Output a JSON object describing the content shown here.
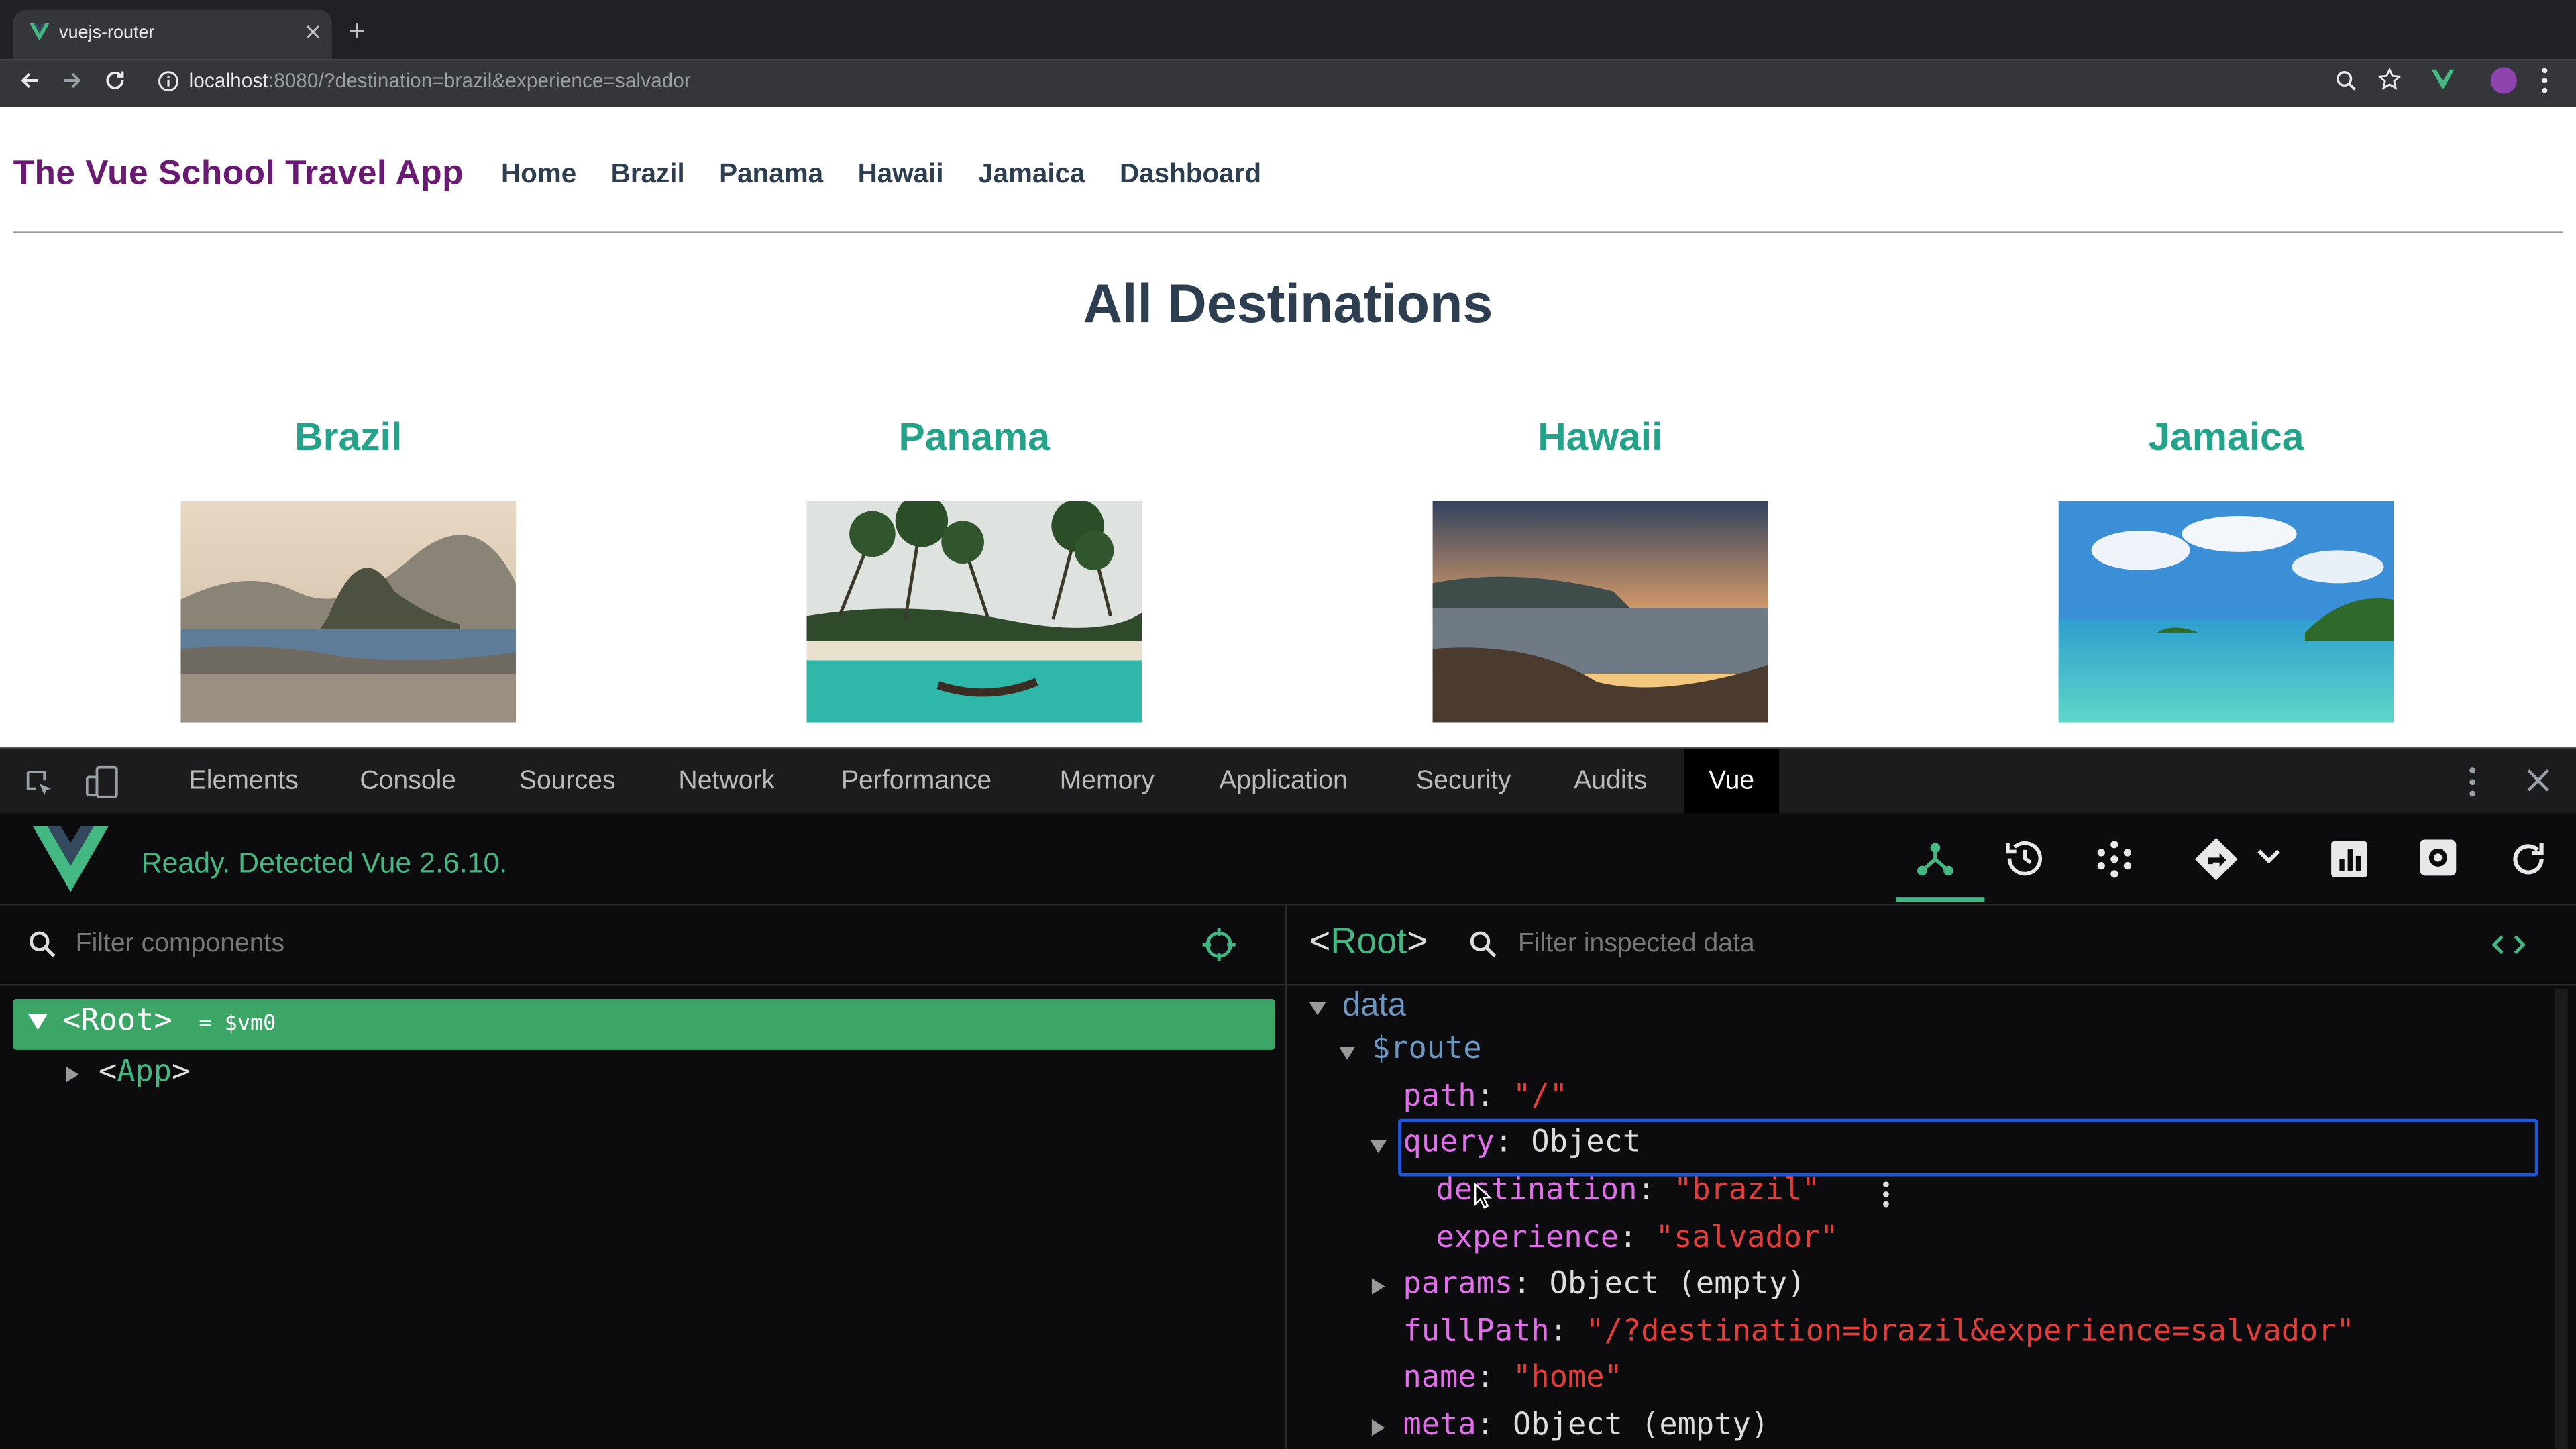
{
  "browser": {
    "tab_title": "vuejs-router",
    "new_tab": "+",
    "url_host": "localhost",
    "url_rest": ":8080/?destination=brazil&experience=salvador"
  },
  "page": {
    "brand": "The Vue School Travel App",
    "nav": [
      "Home",
      "Brazil",
      "Panama",
      "Hawaii",
      "Jamaica",
      "Dashboard"
    ],
    "heading": "All Destinations",
    "destinations": [
      "Brazil",
      "Panama",
      "Hawaii",
      "Jamaica"
    ]
  },
  "devtools": {
    "tabs": [
      "Elements",
      "Console",
      "Sources",
      "Network",
      "Performance",
      "Memory",
      "Application",
      "Security",
      "Audits",
      "Vue"
    ],
    "active_tab": "Vue",
    "status": "Ready. Detected Vue 2.6.10.",
    "filter_components_placeholder": "Filter components",
    "filter_data_placeholder": "Filter inspected data",
    "tree": {
      "root_lt": "<",
      "root_name": "Root",
      "root_gt": ">",
      "root_alias": "= $vm0",
      "child_lt": "<",
      "child_name": "App",
      "child_gt": ">"
    },
    "inspector": {
      "title_lt": "<",
      "title_name": "Root",
      "title_gt": ">",
      "section": "data",
      "route_key": "$route",
      "path_key": "path",
      "path_val": "\"/\"",
      "query_key": "query",
      "query_val": "Object",
      "destination_key": "destination",
      "destination_val": "\"brazil\"",
      "experience_key": "experience",
      "experience_val": "\"salvador\"",
      "params_key": "params",
      "params_val": "Object (empty)",
      "fullpath_key": "fullPath",
      "fullpath_val": "\"/?destination=brazil&experience=salvador\"",
      "name_key": "name",
      "name_val": "\"home\"",
      "meta_key": "meta",
      "meta_val": "Object (empty)",
      "colon": ":"
    }
  },
  "colors": {
    "vue_green": "#43b883",
    "brand_purple": "#6b1a73",
    "dest_teal": "#24a38a",
    "selection_blue": "#1f57d6"
  }
}
